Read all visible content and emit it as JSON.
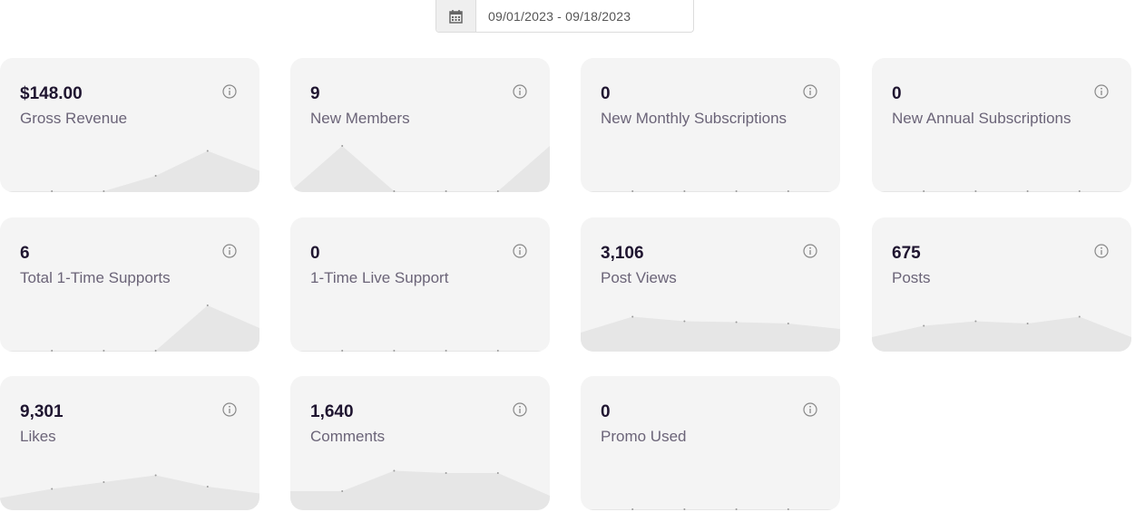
{
  "date_range": {
    "icon": "calendar-icon",
    "value": "09/01/2023 - 09/18/2023"
  },
  "colors": {
    "card_bg": "#f4f4f4",
    "value": "#1f1530",
    "label": "#6b6478",
    "spark_fill": "#e6e6e6"
  },
  "cards": [
    {
      "value": "$148.00",
      "label": "Gross Revenue",
      "icon": "info-icon",
      "spark": [
        0,
        0,
        0,
        0.34,
        0.89,
        0.45
      ]
    },
    {
      "value": "9",
      "label": "New Members",
      "icon": "info-icon",
      "spark": [
        0,
        1,
        0,
        0,
        0,
        1
      ]
    },
    {
      "value": "0",
      "label": "New Monthly Subscriptions",
      "icon": "info-icon",
      "spark": [
        0,
        0,
        0,
        0,
        0,
        0
      ]
    },
    {
      "value": "0",
      "label": "New Annual Subscriptions",
      "icon": "info-icon",
      "spark": [
        0,
        0,
        0,
        0,
        0,
        0
      ]
    },
    {
      "value": "6",
      "label": "Total 1-Time Supports",
      "icon": "info-icon",
      "spark": [
        0,
        0,
        0,
        0,
        1,
        0.5
      ]
    },
    {
      "value": "0",
      "label": "1-Time Live Support",
      "icon": "info-icon",
      "spark": [
        0,
        0,
        0,
        0,
        0,
        0
      ]
    },
    {
      "value": "3,106",
      "label": "Post Views",
      "icon": "info-icon",
      "spark": [
        0.4,
        0.75,
        0.65,
        0.63,
        0.6,
        0.48
      ]
    },
    {
      "value": "675",
      "label": "Posts",
      "icon": "info-icon",
      "spark": [
        0.3,
        0.55,
        0.65,
        0.6,
        0.75,
        0.3
      ]
    },
    {
      "value": "9,301",
      "label": "Likes",
      "icon": "info-icon",
      "spark": [
        0.25,
        0.45,
        0.6,
        0.75,
        0.5,
        0.35
      ]
    },
    {
      "value": "1,640",
      "label": "Comments",
      "icon": "info-icon",
      "spark": [
        0.4,
        0.4,
        0.85,
        0.8,
        0.8,
        0.3
      ]
    },
    {
      "value": "0",
      "label": "Promo Used",
      "icon": "info-icon",
      "spark": [
        0,
        0,
        0,
        0,
        0,
        0
      ]
    }
  ]
}
